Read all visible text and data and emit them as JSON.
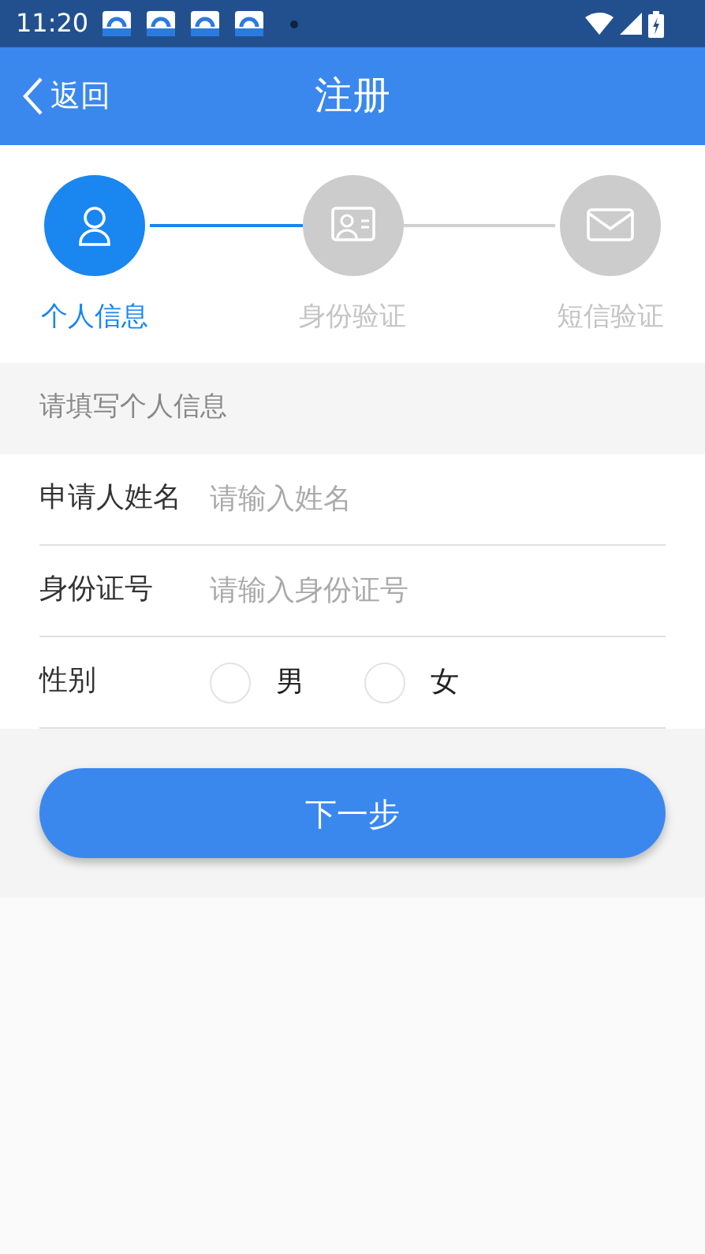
{
  "status_bar": {
    "time": "11:20"
  },
  "header": {
    "back_label": "返回",
    "title": "注册"
  },
  "steps": [
    {
      "label": "个人信息",
      "active": true
    },
    {
      "label": "身份验证",
      "active": false
    },
    {
      "label": "短信验证",
      "active": false
    }
  ],
  "section_title": "请填写个人信息",
  "fields": [
    {
      "kind": "text",
      "label": "申请人姓名",
      "placeholder": "请输入姓名"
    },
    {
      "kind": "text",
      "label": "身份证号",
      "placeholder": "请输入身份证号"
    },
    {
      "kind": "radio",
      "label": "性别",
      "options": [
        {
          "label": "男",
          "selected": false
        },
        {
          "label": "女",
          "selected": false
        }
      ]
    }
  ],
  "next_button": "下一步"
}
